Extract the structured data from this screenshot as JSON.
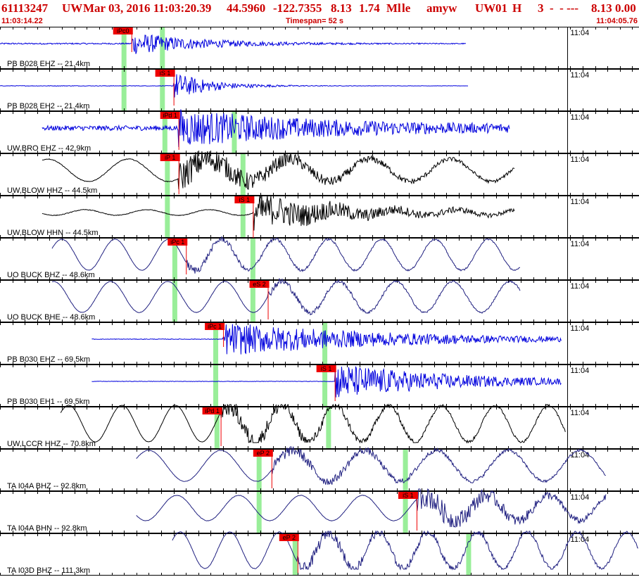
{
  "header": {
    "event_id": "61113247",
    "network": "UW",
    "datetime": "Mar 03, 2016 11:03:20.39",
    "lat": "44.5960",
    "lon": "-122.7355",
    "depth": "8.13",
    "magnitude": "1.74",
    "mag_type": "Ml",
    "event_type": "le",
    "author": "amyw",
    "src_net": "UW",
    "version": "01",
    "flag": "H",
    "extra": "3  -  - ---",
    "tail_a": "8.13",
    "tail_b": "0.00"
  },
  "subline": {
    "start_time": "11:03:14.22",
    "timespan": "Timespan=  52 s",
    "end_time": "11:04:05.76"
  },
  "colors": {
    "header_red": "#cc0000",
    "pick_flag": "#ee0000",
    "hint": "#99ee99",
    "trace_blue": "#0000dd",
    "trace_black": "#000000",
    "trace_navy": "#202080"
  },
  "chart_data": {
    "type": "line",
    "title": "61113247 UW Mar 03, 2016 11:03:20.39",
    "x_unit": "seconds",
    "time_range": [
      0,
      51.54
    ],
    "minute_marker_seconds": 45.78,
    "minute_marker_label": "11:04",
    "second_ticks_every": 1,
    "channels": [
      {
        "label": "PB B028 EHZ -- 21.4km",
        "color": "#0000dd",
        "style": "hf",
        "start_s": 0.0,
        "end_s": 37.6,
        "onset_s": 10.6,
        "coda_s": 6.0,
        "amp": 16,
        "pre_amp": 1.0,
        "base": 0.5,
        "picks": [
          {
            "label": "iPc0",
            "t": 10.6,
            "tail": 36
          }
        ],
        "hints": [
          10.0,
          13.1
        ]
      },
      {
        "label": "PB B028 EH2 -- 21.4km",
        "color": "#0000dd",
        "style": "hf",
        "start_s": 0.0,
        "end_s": 37.8,
        "onset_s": 14.0,
        "coda_s": 3.0,
        "amp": 20,
        "pre_amp": 0.4,
        "base": 0.2,
        "picks": [
          {
            "label": "iS 1",
            "t": 14.0,
            "tail": 52
          }
        ],
        "hints": [
          10.0,
          13.1
        ]
      },
      {
        "label": "UW,BRO EHZ -- 42.9km",
        "color": "#0000dd",
        "style": "hf",
        "start_s": 3.4,
        "end_s": 41.1,
        "onset_s": 14.4,
        "coda_s": 12.0,
        "amp": 24,
        "pre_amp": 3.5,
        "base": 4.0,
        "picks": [
          {
            "label": "iPd 1",
            "t": 14.4,
            "tail": 55
          }
        ],
        "hints": [
          13.3,
          18.9
        ]
      },
      {
        "label": "UW,BLOW HHZ -- 44.5km",
        "color": "#000000",
        "style": "lp_hf",
        "start_s": 3.4,
        "end_s": 41.5,
        "onset_s": 14.4,
        "coda_s": 9.0,
        "amp": 22,
        "lp_amp": 16,
        "lp_period": 6.5,
        "pre_amp": 0.5,
        "base": 1.0,
        "picks": [
          {
            "label": "iP 1",
            "t": 14.4,
            "tail": 58
          }
        ],
        "hints": [
          13.5,
          19.6
        ]
      },
      {
        "label": "UW,BLOW HHN -- 44.5km",
        "color": "#000000",
        "style": "lp_hf",
        "start_s": 3.4,
        "end_s": 41.5,
        "onset_s": 20.4,
        "coda_s": 8.0,
        "amp": 25,
        "lp_amp": 4,
        "lp_period": 5.0,
        "pre_amp": 0.5,
        "base": 1.0,
        "picks": [
          {
            "label": "iS 1",
            "t": 20.4,
            "tail": 60
          }
        ],
        "hints": [
          13.5,
          19.6
        ]
      },
      {
        "label": "UO BUCK BHZ -- 48.6km",
        "color": "#202080",
        "style": "lp",
        "start_s": 4.2,
        "end_s": 42.0,
        "onset_s": 15.0,
        "coda_s": 5.0,
        "amp": 5,
        "lp_amp": 22,
        "lp_period": 4.3,
        "pre_amp": 0.3,
        "base": 1.0,
        "picks": [
          {
            "label": "iPc 1",
            "t": 15.0,
            "tail": 52
          }
        ],
        "hints": [
          14.1,
          20.4
        ]
      },
      {
        "label": "UO BUCK BHE -- 48.6km",
        "color": "#202080",
        "style": "lp",
        "start_s": 4.2,
        "end_s": 42.0,
        "onset_s": 21.6,
        "coda_s": 5.0,
        "amp": 5,
        "lp_amp": 22,
        "lp_period": 4.6,
        "pre_amp": 0.3,
        "base": 1.0,
        "picks": [
          {
            "label": "eS 2",
            "t": 21.6,
            "tail": 56
          }
        ],
        "hints": [
          14.1,
          20.4
        ]
      },
      {
        "label": "PB B030 EHZ -- 69.5km",
        "color": "#0000dd",
        "style": "hf",
        "start_s": 7.4,
        "end_s": 45.3,
        "onset_s": 18.0,
        "coda_s": 14.0,
        "amp": 24,
        "pre_amp": 0.4,
        "base": 0.3,
        "picks": [
          {
            "label": "iPc 1",
            "t": 18.0,
            "tail": 35
          }
        ],
        "hints": [
          17.4,
          26.2
        ]
      },
      {
        "label": "PB B030 EH1 -- 69.5km",
        "color": "#0000dd",
        "style": "hf",
        "start_s": 7.4,
        "end_s": 45.3,
        "onset_s": 27.0,
        "coda_s": 10.0,
        "amp": 26,
        "pre_amp": 0.3,
        "base": 0.2,
        "picks": [
          {
            "label": "iS 1",
            "t": 27.0,
            "tail": 52
          }
        ],
        "hints": [
          17.4,
          26.2
        ]
      },
      {
        "label": "UW,LCCR HHZ -- 70.8km",
        "color": "#000000",
        "style": "lp_hf",
        "start_s": 4.9,
        "end_s": 45.6,
        "onset_s": 17.8,
        "coda_s": 8.0,
        "amp": 14,
        "lp_amp": 26,
        "lp_period": 4.3,
        "pre_amp": 0.3,
        "base": 1.0,
        "picks": [
          {
            "label": "iPd 1",
            "t": 17.8,
            "tail": 56
          }
        ],
        "hints": [
          17.5,
          26.5
        ]
      },
      {
        "label": "TA I04A BHZ -- 92.8km",
        "color": "#202080",
        "style": "lp",
        "start_s": 11.0,
        "end_s": 48.9,
        "onset_s": 21.9,
        "coda_s": 10.0,
        "amp": 8,
        "lp_amp": 22,
        "lp_period": 5.8,
        "pre_amp": 0.3,
        "base": 1.0,
        "picks": [
          {
            "label": "eP 2",
            "t": 21.9,
            "tail": 56
          }
        ],
        "hints": [
          20.9,
          32.7
        ]
      },
      {
        "label": "TA I04A BHN -- 92.8km",
        "color": "#202080",
        "style": "lp",
        "start_s": 11.0,
        "end_s": 48.9,
        "onset_s": 33.6,
        "coda_s": 8.0,
        "amp": 18,
        "lp_amp": 18,
        "lp_period": 5.0,
        "pre_amp": 0.3,
        "base": 1.0,
        "picks": [
          {
            "label": "iS 1",
            "t": 33.6,
            "tail": 56
          }
        ],
        "hints": [
          20.9,
          32.7
        ]
      },
      {
        "label": "TA I03D BHZ -- 111.3km",
        "color": "#202080",
        "style": "lp",
        "start_s": 13.9,
        "end_s": 51.5,
        "onset_s": 24.0,
        "coda_s": 12.0,
        "amp": 8,
        "lp_amp": 26,
        "lp_period": 4.0,
        "pre_amp": 0.4,
        "base": 1.0,
        "picks": [
          {
            "label": "eP 2",
            "t": 24.0,
            "tail": 56
          }
        ],
        "hints": [
          23.8,
          37.8
        ]
      }
    ]
  }
}
